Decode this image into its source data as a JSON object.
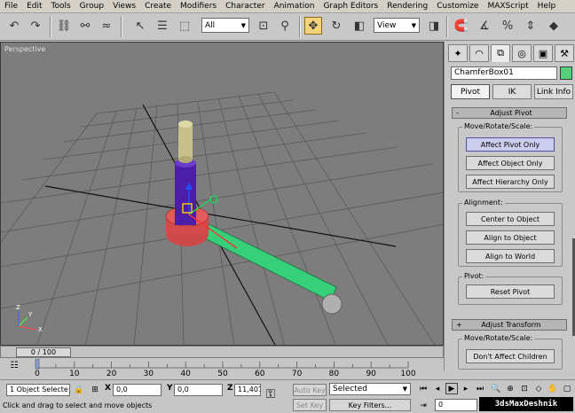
{
  "menu": [
    "File",
    "Edit",
    "Tools",
    "Group",
    "Views",
    "Create",
    "Modifiers",
    "Character",
    "Animation",
    "Graph Editors",
    "Rendering",
    "Customize",
    "MAXScript",
    "Help"
  ],
  "toolbar": {
    "selection_filter": "All",
    "ref_coord": "View"
  },
  "viewport": {
    "label": "Perspective",
    "axis_x": "X",
    "axis_y": "Y",
    "axis_z": "Z"
  },
  "command_panel": {
    "object_name": "ChamferBox01",
    "object_color": "#55d07a",
    "hierarchy_tabs": [
      "Pivot",
      "IK",
      "Link Info"
    ],
    "active_hierarchy_tab": "Pivot",
    "adjust_pivot": {
      "sign": "-",
      "title": "Adjust Pivot",
      "move_group_title": "Move/Rotate/Scale:",
      "affect_pivot_only": "Affect Pivot Only",
      "affect_object_only": "Affect Object Only",
      "affect_hierarchy_only": "Affect Hierarchy Only",
      "alignment_title": "Alignment:",
      "center_to_object": "Center to Object",
      "align_to_object": "Align to Object",
      "align_to_world": "Align to World",
      "pivot_title": "Pivot:",
      "reset_pivot": "Reset Pivot"
    },
    "adjust_transform": {
      "sign": "+",
      "title": "Adjust Transform",
      "move_group_title": "Move/Rotate/Scale:",
      "dont_affect_children": "Don't Affect Children"
    }
  },
  "timeline": {
    "slider_text": "0 / 100",
    "ticks": [
      "0",
      "10",
      "20",
      "30",
      "40",
      "50",
      "60",
      "70",
      "80",
      "90",
      "100"
    ]
  },
  "status": {
    "selection_count": "1 Object Selecte",
    "x_label": "X",
    "x_value": "0,0",
    "y_label": "Y",
    "y_value": "0,0",
    "z_label": "Z",
    "z_value": "11,407",
    "auto_key": "Auto Key",
    "set_key": "Set Key",
    "key_mode": "Selected",
    "key_filters": "Key Filters...",
    "current_frame": "0",
    "prompt": "Click and drag to select and move objects"
  },
  "watermark": "3dsMaxDeshnik"
}
